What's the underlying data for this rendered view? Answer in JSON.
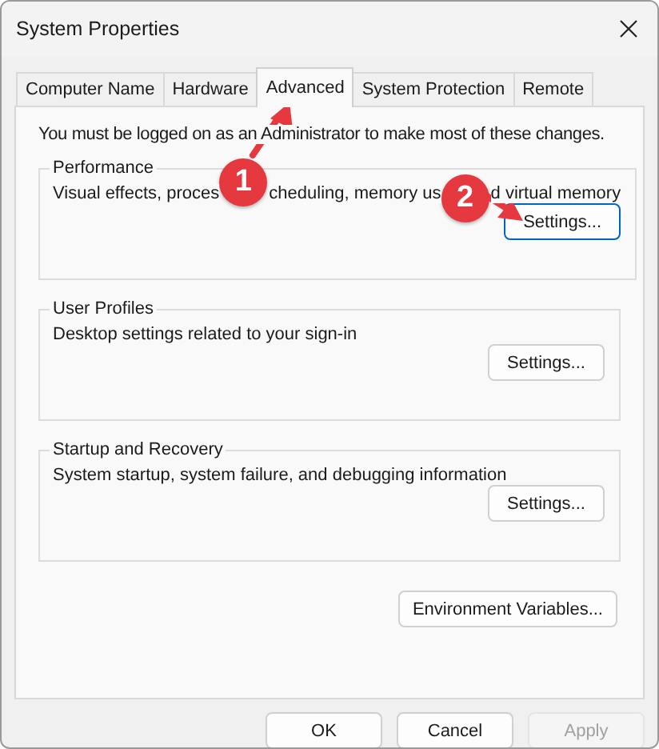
{
  "window": {
    "title": "System Properties"
  },
  "tabs": [
    {
      "label": "Computer Name",
      "selected": false
    },
    {
      "label": "Hardware",
      "selected": false
    },
    {
      "label": "Advanced",
      "selected": true
    },
    {
      "label": "System Protection",
      "selected": false
    },
    {
      "label": "Remote",
      "selected": false
    }
  ],
  "notice": "You must be logged on as an Administrator to make most of these changes.",
  "groups": [
    {
      "title": "Performance",
      "description_parts": [
        "Visual effects, proces",
        "cheduling, memory us",
        "d virtual memory"
      ],
      "callouts": [
        {
          "label": "1",
          "kind": "up"
        },
        {
          "label": "2",
          "kind": "down"
        }
      ],
      "button": {
        "label": "Settings...",
        "focused": true
      }
    },
    {
      "title": "User Profiles",
      "description_parts": [
        "Desktop settings related to your sign-in"
      ],
      "button": {
        "label": "Settings...",
        "focused": false
      }
    },
    {
      "title": "Startup and Recovery",
      "description_parts": [
        "System startup, system failure, and debugging information"
      ],
      "button": {
        "label": "Settings...",
        "focused": false
      }
    }
  ],
  "environment_button": {
    "label": "Environment Variables..."
  },
  "buttons": [
    {
      "label": "OK",
      "disabled": false
    },
    {
      "label": "Cancel",
      "disabled": false
    },
    {
      "label": "Apply",
      "disabled": true
    }
  ]
}
